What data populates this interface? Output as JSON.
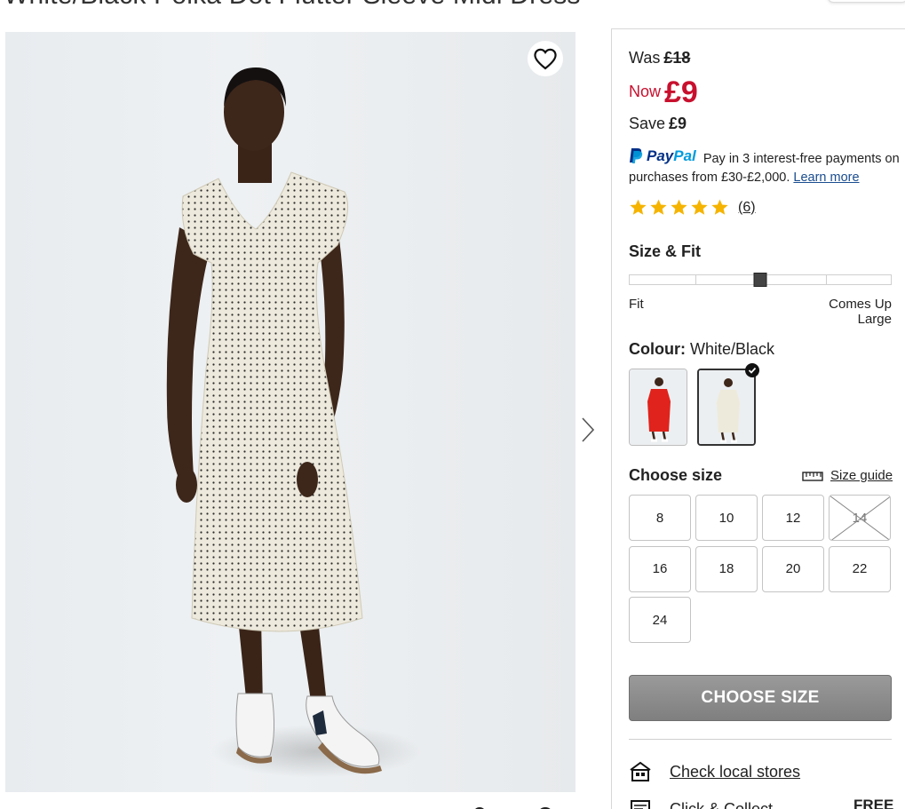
{
  "product": {
    "title": "White/Black Polka Dot Flutter Sleeve Midi Dress"
  },
  "gallery": {
    "wishlist_icon": "heart-outline-icon",
    "next_icon": "chevron-right-icon"
  },
  "price": {
    "was_label": "Was",
    "was_value": "£18",
    "now_label": "Now",
    "now_value": "£9",
    "save_label": "Save",
    "save_value": "£9",
    "sale_color": "#c8102e"
  },
  "paypal": {
    "logo_pay": "Pay",
    "logo_pal": "Pal",
    "message": "Pay in 3 interest-free payments on purchases from £30-£2,000.",
    "learn_more": "Learn more"
  },
  "reviews": {
    "rating": 5,
    "max": 5,
    "count_text": "(6)",
    "star_color": "#f5b400"
  },
  "size_fit": {
    "title": "Size & Fit",
    "left_label": "Fit",
    "right_label": "Comes Up Large",
    "segments": 4,
    "position_fraction": 0.5
  },
  "colour": {
    "label": "Colour:",
    "value": "White/Black",
    "swatches": [
      {
        "name": "Red",
        "dress_color": "#e0231c",
        "selected": false
      },
      {
        "name": "White/Black",
        "dress_color": "#eeeadb",
        "selected": true
      }
    ]
  },
  "sizes": {
    "title": "Choose size",
    "guide_label": "Size guide",
    "guide_icon": "ruler-icon",
    "options": [
      {
        "label": "8",
        "available": true
      },
      {
        "label": "10",
        "available": true
      },
      {
        "label": "12",
        "available": true
      },
      {
        "label": "14",
        "available": false
      },
      {
        "label": "16",
        "available": true
      },
      {
        "label": "18",
        "available": true
      },
      {
        "label": "20",
        "available": true
      },
      {
        "label": "22",
        "available": true
      },
      {
        "label": "24",
        "available": true
      }
    ]
  },
  "cta": {
    "label": "CHOOSE SIZE"
  },
  "delivery": {
    "local_label": "Check local stores",
    "local_icon": "store-icon",
    "cc_label": "Click & Collect",
    "cc_icon": "click-collect-icon",
    "cc_price": "FREE"
  }
}
